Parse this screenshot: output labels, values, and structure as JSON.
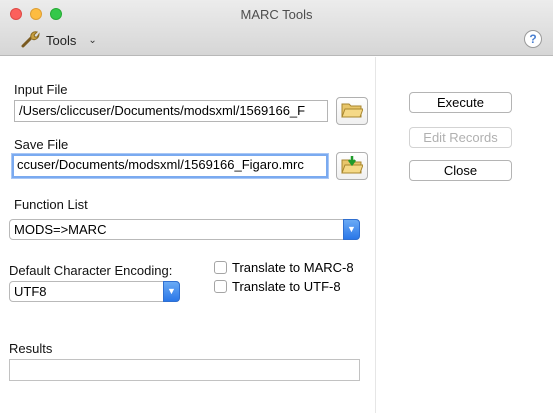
{
  "window": {
    "title": "MARC Tools"
  },
  "toolbar": {
    "tools_label": "Tools",
    "help_label": "?"
  },
  "input_file": {
    "label": "Input File",
    "value": "/Users/cliccuser/Documents/modsxml/1569166_F"
  },
  "save_file": {
    "label": "Save File",
    "value": "ccuser/Documents/modsxml/1569166_Figaro.mrc"
  },
  "function_list": {
    "label": "Function List",
    "selected": "MODS=>MARC"
  },
  "encoding": {
    "label": "Default Character Encoding:",
    "selected": "UTF8"
  },
  "options": {
    "translate_marc8": "Translate to MARC-8",
    "translate_utf8": "Translate to UTF-8"
  },
  "results": {
    "label": "Results",
    "value": ""
  },
  "buttons": {
    "execute": "Execute",
    "edit_records": "Edit Records",
    "close": "Close"
  },
  "icons": {
    "tools": "wrench-icon",
    "open_folder": "open-folder-icon",
    "save_folder": "save-folder-icon"
  },
  "colors": {
    "accent": "#2a77e8",
    "focus_ring": "#7aaaf0"
  }
}
